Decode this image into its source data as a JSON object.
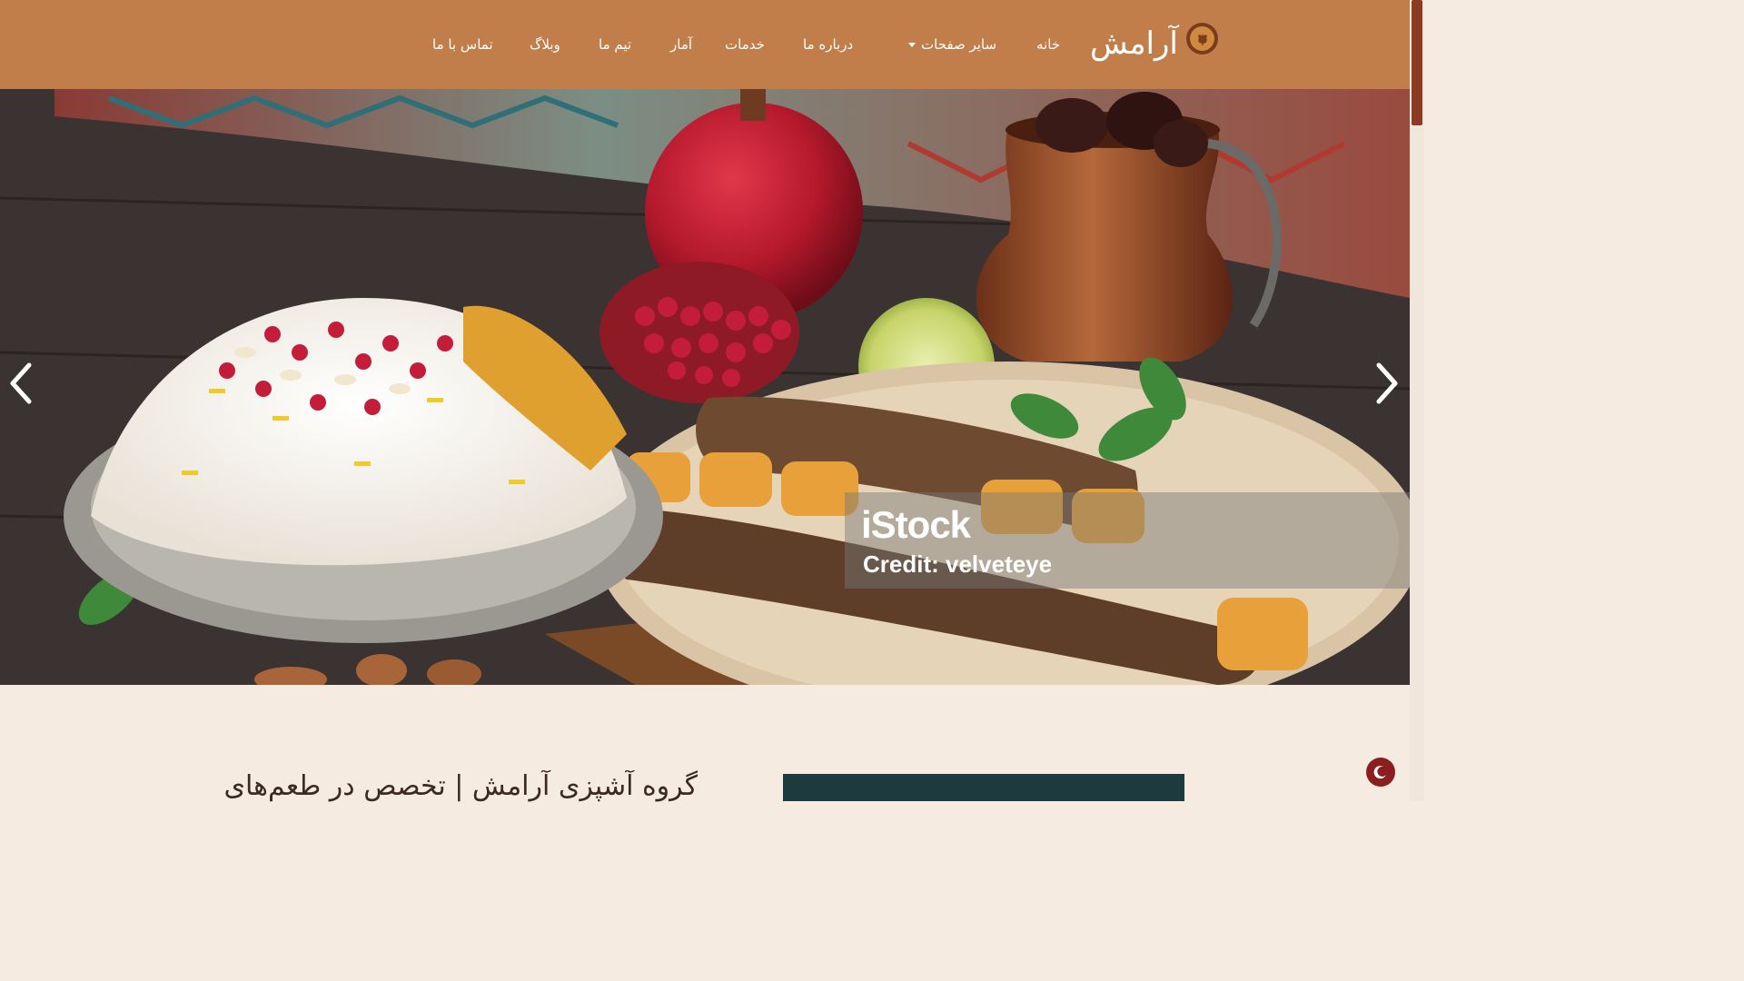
{
  "header": {
    "brand": "آرامش",
    "logo_icon": "wheat-logo-icon",
    "nav": {
      "home": "خانه",
      "other_pages": "سایر صفحات",
      "about": "درباره ما",
      "services": "خدمات",
      "stats": "آمار",
      "team": "تیم ما",
      "blog": "وبلاگ",
      "contact": "تماس با ما"
    },
    "colors": {
      "background": "#c17e4a",
      "text": "#ffffff"
    }
  },
  "hero": {
    "watermark": {
      "brand": "iStock",
      "credit": "Credit: velveteye"
    },
    "prev_icon": "chevron-left-icon",
    "next_icon": "chevron-right-icon"
  },
  "intro": {
    "heading": "گروه آشپزی آرامش | تخصص در طعم‌های"
  },
  "ui": {
    "dark_mode_icon": "moon-icon",
    "accent": "#8b1e1e",
    "page_background": "#f5ebe0"
  }
}
